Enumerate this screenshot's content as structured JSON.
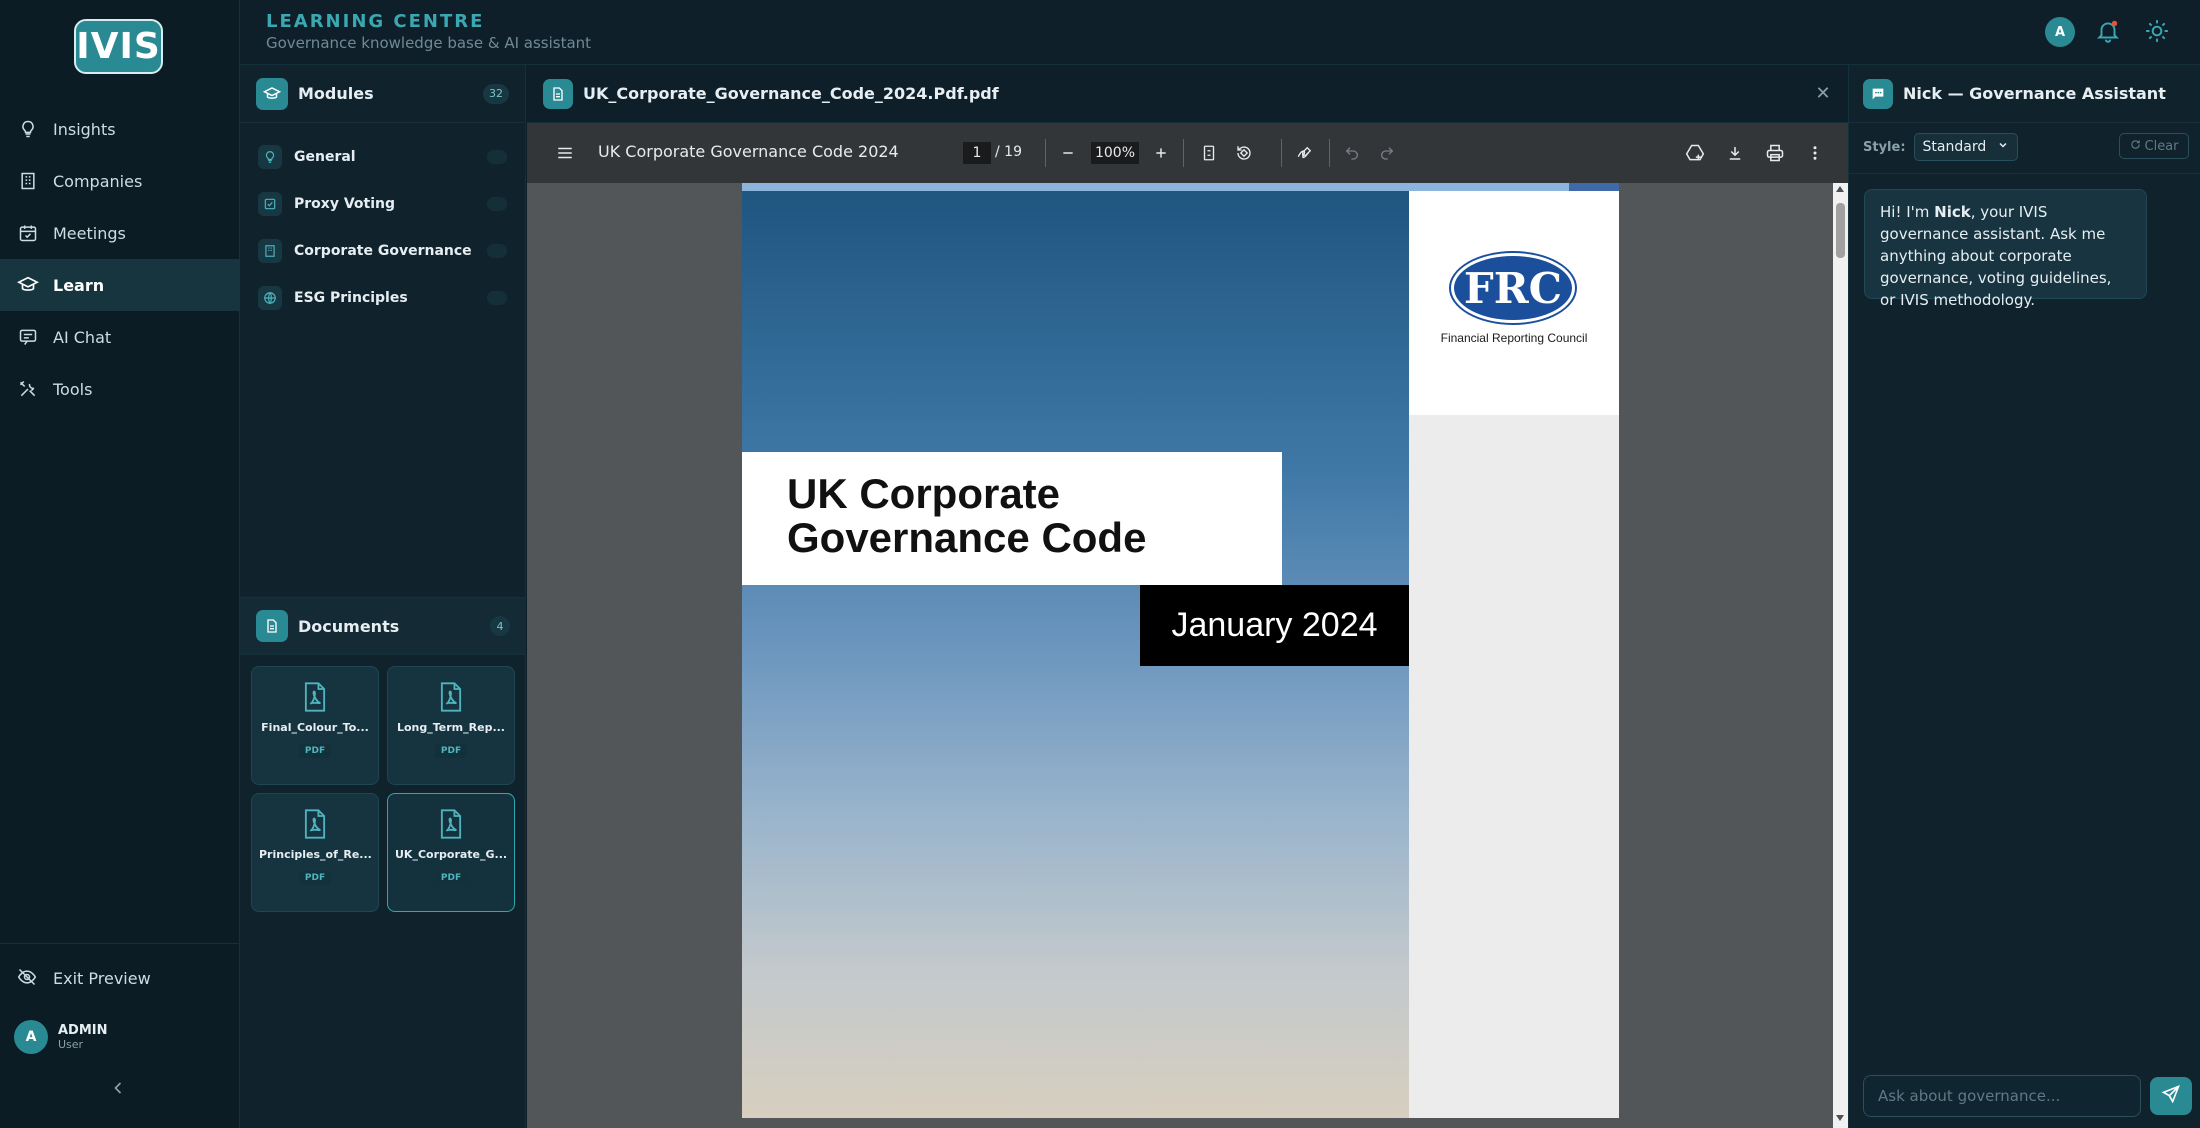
{
  "app": {
    "logo_text": "IVIS"
  },
  "nav": {
    "items": [
      {
        "label": "Insights",
        "icon": "lightbulb-icon"
      },
      {
        "label": "Companies",
        "icon": "building-icon"
      },
      {
        "label": "Meetings",
        "icon": "calendar-check-icon"
      },
      {
        "label": "Learn",
        "icon": "graduation-cap-icon",
        "active": true
      },
      {
        "label": "AI Chat",
        "icon": "chat-icon"
      },
      {
        "label": "Tools",
        "icon": "tools-icon"
      }
    ],
    "exit_preview": "Exit Preview",
    "user": {
      "initial": "A",
      "name": "ADMIN",
      "role": "User"
    }
  },
  "header": {
    "title": "LEARNING CENTRE",
    "subtitle": "Governance knowledge base & AI assistant",
    "avatar_initial": "A"
  },
  "modules": {
    "title": "Modules",
    "count": "32",
    "items": [
      {
        "label": "General",
        "icon": "lightbulb-icon"
      },
      {
        "label": "Proxy Voting",
        "icon": "check-square-icon"
      },
      {
        "label": "Corporate Governance",
        "icon": "building-icon"
      },
      {
        "label": "ESG Principles",
        "icon": "globe-icon"
      }
    ]
  },
  "documents": {
    "title": "Documents",
    "count": "4",
    "items": [
      {
        "name": "Final_Colour_To...",
        "type": "PDF"
      },
      {
        "name": "Long_Term_Rep...",
        "type": "PDF"
      },
      {
        "name": "Principles_of_Re...",
        "type": "PDF"
      },
      {
        "name": "UK_Corporate_G...",
        "type": "PDF",
        "selected": true
      }
    ]
  },
  "viewer": {
    "file_name": "UK_Corporate_Governance_Code_2024.Pdf.pdf",
    "toolbar": {
      "doc_title": "UK Corporate Governance Code 2024",
      "page_current": "1",
      "page_total": "/ 19",
      "zoom": "100%"
    },
    "page": {
      "title": "UK Corporate Governance Code",
      "date": "January 2024",
      "logo_text": "FRC",
      "logo_caption": "Financial Reporting Council"
    }
  },
  "assistant": {
    "title": "Nick — Governance Assistant",
    "style_label": "Style:",
    "style_value": "Standard",
    "clear_label": "Clear",
    "message": {
      "prefix": "Hi! I'm ",
      "name": "Nick",
      "suffix": ", your IVIS governance assistant. Ask me anything about corporate governance, voting guidelines, or IVIS methodology."
    },
    "input_placeholder": "Ask about governance..."
  }
}
